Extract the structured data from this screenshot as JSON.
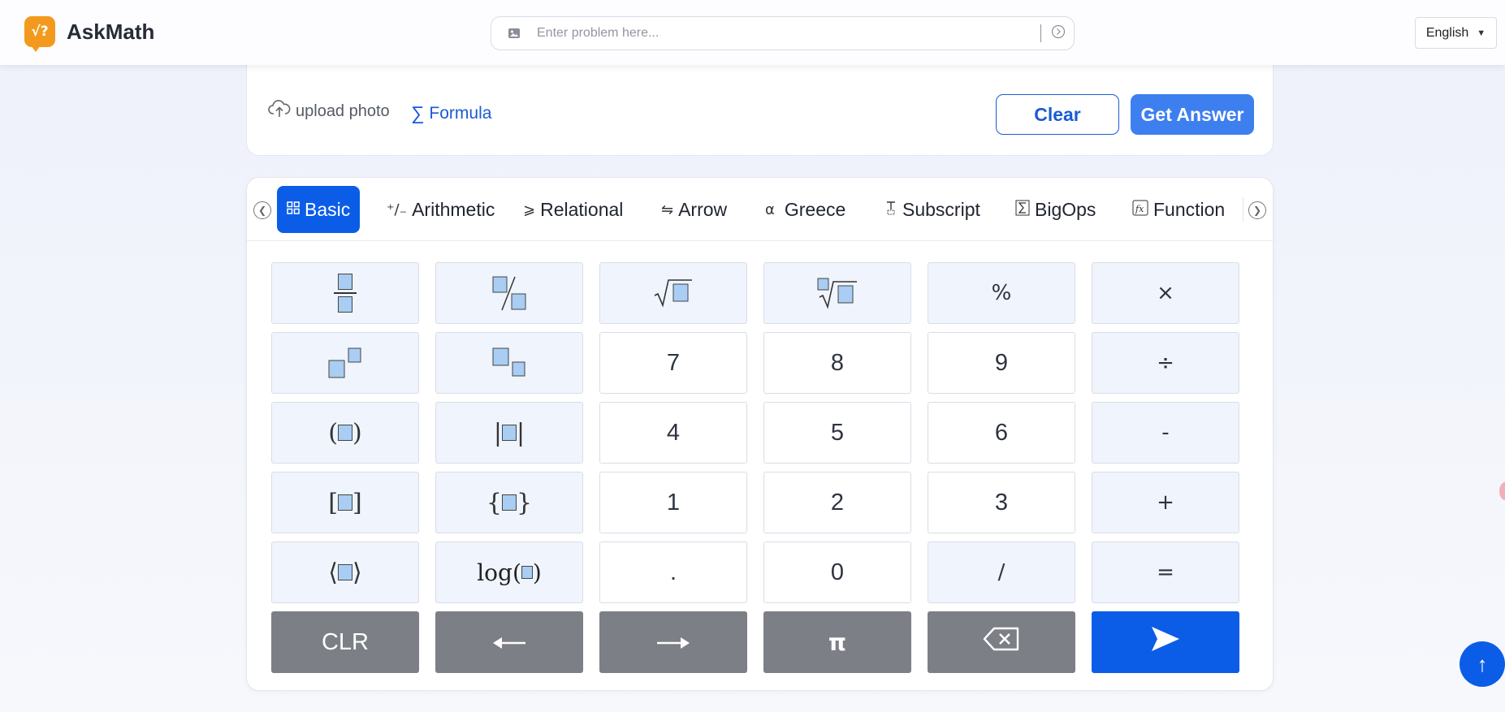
{
  "header": {
    "brand": "AskMath",
    "logo_glyph": "√?",
    "search_placeholder": "Enter problem here...",
    "language": "English"
  },
  "input_card": {
    "upload_label": "upload photo",
    "formula_label": "Formula",
    "clear_label": "Clear",
    "answer_label": "Get Answer"
  },
  "tabs": [
    {
      "label": "Basic",
      "active": true
    },
    {
      "label": "Arithmetic"
    },
    {
      "label": "Relational"
    },
    {
      "label": "Arrow"
    },
    {
      "label": "Greece"
    },
    {
      "label": "Subscript"
    },
    {
      "label": "BigOps"
    },
    {
      "label": "Function"
    }
  ],
  "keys": {
    "seven": "7",
    "eight": "8",
    "nine": "9",
    "four": "4",
    "five": "5",
    "six": "6",
    "one": "1",
    "two": "2",
    "three": "3",
    "dot": ".",
    "zero": "0",
    "percent": "%",
    "times": "×",
    "divide": "÷",
    "minus": "-",
    "plus": "+",
    "slash": "/",
    "equals": "=",
    "clr": "CLR",
    "pi": "π",
    "log": "log"
  },
  "colors": {
    "accent": "#0b5de8",
    "logo": "#f39a1e",
    "dark_key": "#7d7f86",
    "template_key_bg": "#eff4fd"
  }
}
